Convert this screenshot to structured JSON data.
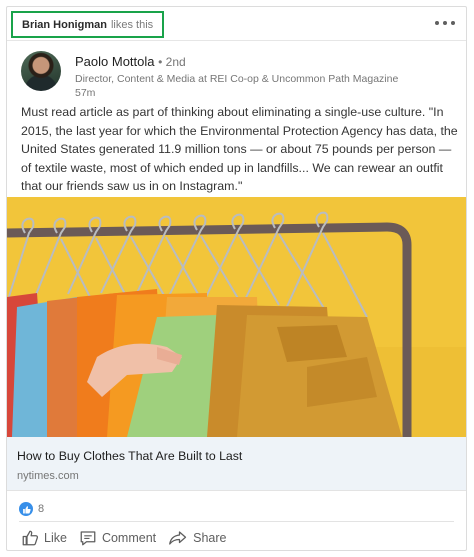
{
  "context": {
    "actor_name": "Brian Honigman",
    "action_text": "likes this",
    "highlight_color": "#19a34a"
  },
  "menu": {
    "icon": "more-horizontal-icon"
  },
  "actor": {
    "name": "Paolo Mottola",
    "degree": "• 2nd",
    "headline": "Director, Content & Media at REI Co-op & Uncommon Path Magazine",
    "time": "57m"
  },
  "commentary": "Must read article as part of thinking about eliminating a single-use culture. \"In 2015, the last year for which the Environmental Protection Agency has data, the United States generated 11.9 million tons — or about 75 pounds per person — of textile waste, most of which ended up in landfills... We can rewear an outfit that our friends saw us in on Instagram.\"",
  "article": {
    "image_description_icon": "clothing-rack-photo",
    "title": "How to Buy Clothes That Are Built to Last",
    "source": "nytimes.com"
  },
  "social_counts": {
    "reaction_icon": "like-reaction-icon",
    "count": "8",
    "accent_color": "#378fe9"
  },
  "actions": [
    {
      "label": "Like",
      "icon": "thumbs-up-icon"
    },
    {
      "label": "Comment",
      "icon": "comment-icon"
    },
    {
      "label": "Share",
      "icon": "share-arrow-icon"
    }
  ]
}
